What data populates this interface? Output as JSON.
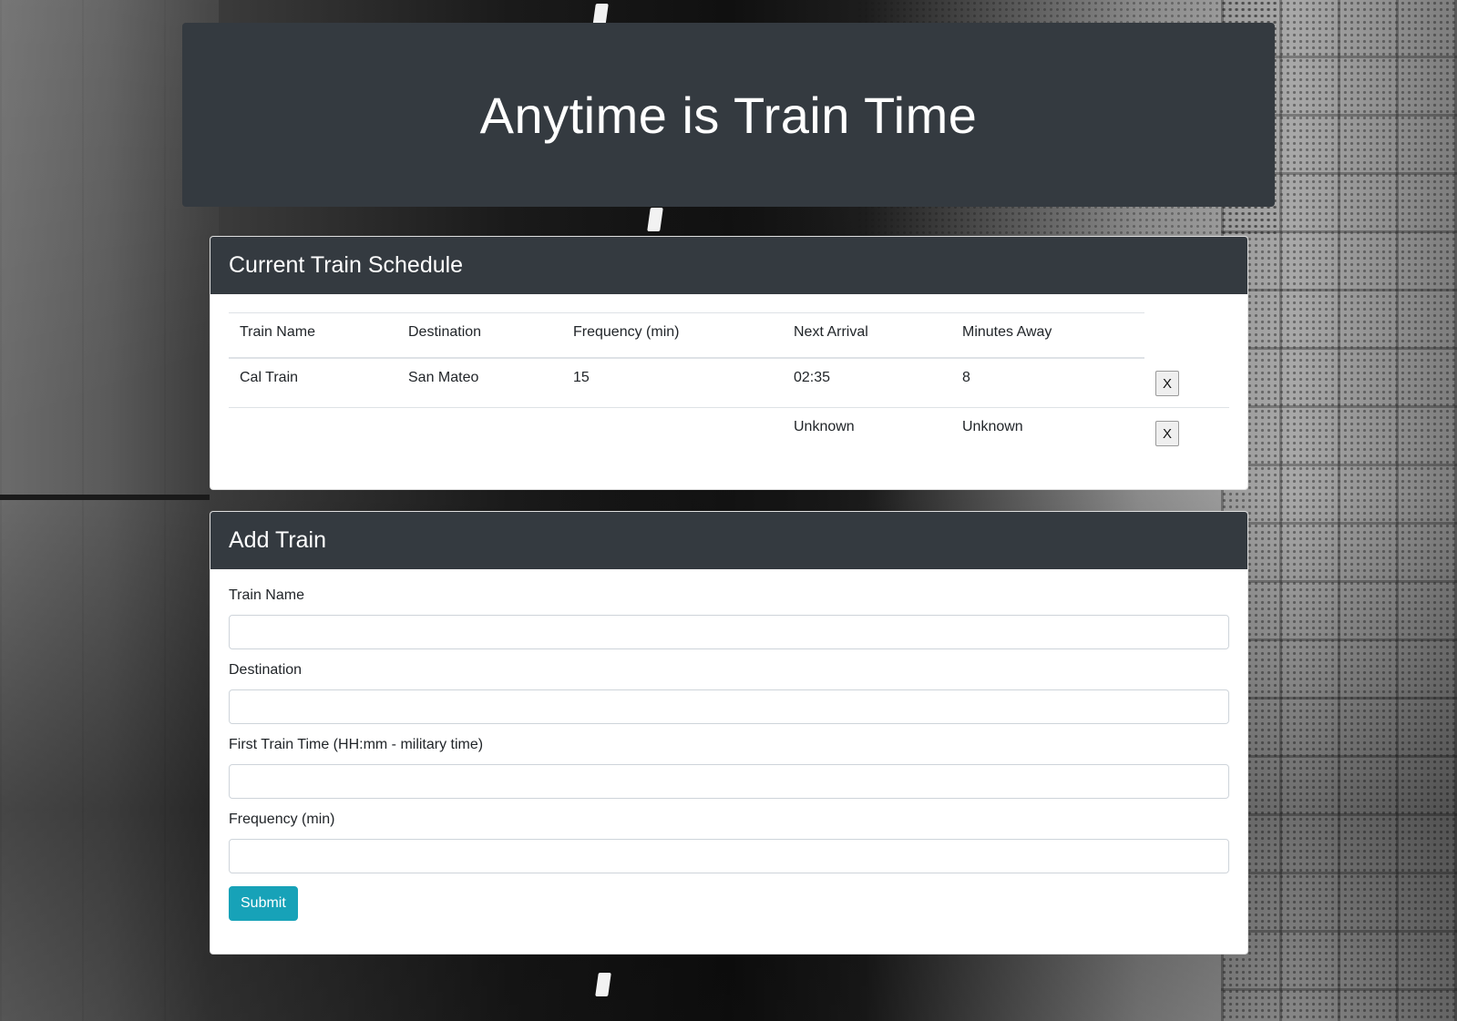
{
  "header": {
    "title": "Anytime is Train Time"
  },
  "schedule": {
    "heading": "Current Train Schedule",
    "columns": [
      "Train Name",
      "Destination",
      "Frequency (min)",
      "Next Arrival",
      "Minutes Away"
    ],
    "rows": [
      {
        "name": "Cal Train",
        "destination": "San Mateo",
        "frequency": "15",
        "next_arrival": "02:35",
        "minutes_away": "8",
        "remove_label": "X"
      },
      {
        "name": "",
        "destination": "",
        "frequency": "",
        "next_arrival": "Unknown",
        "minutes_away": "Unknown",
        "remove_label": "X"
      }
    ]
  },
  "add_train": {
    "heading": "Add Train",
    "fields": {
      "train_name": {
        "label": "Train Name",
        "value": ""
      },
      "destination": {
        "label": "Destination",
        "value": ""
      },
      "first_train_time": {
        "label": "First Train Time (HH:mm - military time)",
        "value": ""
      },
      "frequency": {
        "label": "Frequency (min)",
        "value": ""
      }
    },
    "submit_label": "Submit"
  },
  "colors": {
    "header_bg": "#343a40",
    "submit_bg": "#17a2b8"
  }
}
